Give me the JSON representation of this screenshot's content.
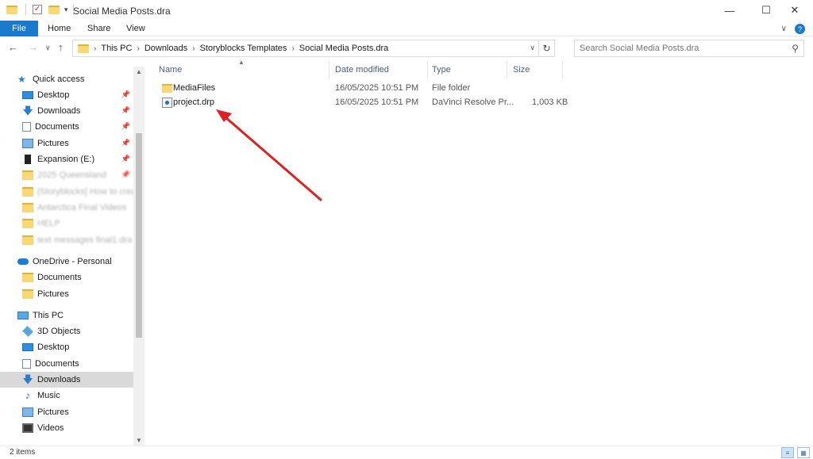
{
  "window": {
    "title": "Social Media Posts.dra",
    "minimize_icon": "minimize-icon",
    "maximize_icon": "maximize-icon",
    "close_icon": "close-icon"
  },
  "ribbon": {
    "tabs": [
      {
        "label": "File"
      },
      {
        "label": "Home"
      },
      {
        "label": "Share"
      },
      {
        "label": "View"
      }
    ],
    "accent": "#1979ca"
  },
  "address": {
    "breadcrumbs": [
      "This PC",
      "Downloads",
      "Storyblocks Templates",
      "Social Media Posts.dra"
    ]
  },
  "search": {
    "placeholder": "Search Social Media Posts.dra"
  },
  "sidebar": {
    "quick_access": "Quick access",
    "quick_items": [
      {
        "label": "Desktop",
        "icon": "desktop-icon"
      },
      {
        "label": "Downloads",
        "icon": "download-arrow-icon"
      },
      {
        "label": "Documents",
        "icon": "document-icon"
      },
      {
        "label": "Pictures",
        "icon": "pictures-icon"
      },
      {
        "label": "Expansion (E:)",
        "icon": "drive-icon"
      },
      {
        "label": "2025 Queensland",
        "icon": "folder-icon"
      },
      {
        "label": "[Storyblocks] How to create",
        "icon": "folder-icon"
      },
      {
        "label": "Antarctica Final Videos",
        "icon": "folder-icon"
      },
      {
        "label": "HELP",
        "icon": "folder-icon"
      },
      {
        "label": "text messages final1.dra",
        "icon": "folder-icon"
      }
    ],
    "onedrive": "OneDrive - Personal",
    "onedrive_items": [
      {
        "label": "Documents"
      },
      {
        "label": "Pictures"
      }
    ],
    "this_pc": "This PC",
    "pc_items": [
      {
        "label": "3D Objects"
      },
      {
        "label": "Desktop"
      },
      {
        "label": "Documents"
      },
      {
        "label": "Downloads"
      },
      {
        "label": "Music"
      },
      {
        "label": "Pictures"
      },
      {
        "label": "Videos"
      }
    ]
  },
  "columns": {
    "name": "Name",
    "date": "Date modified",
    "type": "Type",
    "size": "Size"
  },
  "files": [
    {
      "name": "MediaFiles",
      "date": "16/05/2025 10:51 PM",
      "type": "File folder",
      "size": "",
      "icon": "folder-icon"
    },
    {
      "name": "project.drp",
      "date": "16/05/2025 10:51 PM",
      "type": "DaVinci Resolve Pr...",
      "size": "1,003 KB",
      "icon": "drp-file-icon"
    }
  ],
  "status": {
    "count": "2 items"
  },
  "annotation": {
    "color": "#e02020"
  }
}
